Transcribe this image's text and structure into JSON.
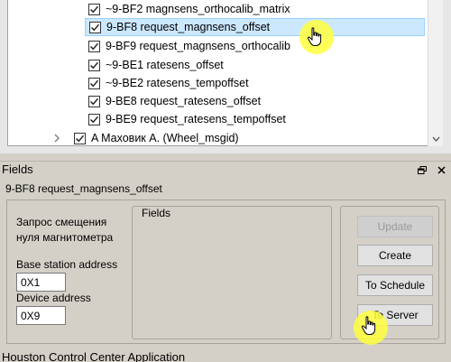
{
  "tree": {
    "items": [
      {
        "label": "~9-BF2 magnsens_orthocalib_matrix",
        "checked": true
      },
      {
        "label": "9-BF8 request_magnsens_offset",
        "checked": true,
        "selected": true
      },
      {
        "label": "9-BF9 request_magnsens_orthocalib",
        "checked": true
      },
      {
        "label": "~9-BE1 ratesens_offset",
        "checked": true
      },
      {
        "label": "~9-BE2 ratesens_tempoffset",
        "checked": true
      },
      {
        "label": "9-BE8 request_ratesens_offset",
        "checked": true
      },
      {
        "label": "9-BE9 request_ratesens_tempoffset",
        "checked": true
      }
    ],
    "collapsed_item": {
      "label": "A Маховик A. (Wheel_msgid)",
      "checked": true
    }
  },
  "fields_panel": {
    "title": "Fields",
    "message_name": "9-BF8 request_magnsens_offset",
    "description": "Запрос смещения нуля магнитометра",
    "base_station_label": "Base station address",
    "base_station_value": "0X1",
    "device_label": "Device address",
    "device_value": "0X9",
    "fields_group_title": "Fields",
    "buttons": {
      "update": "Update",
      "create": "Create",
      "schedule": "To Schedule",
      "server": "To Server"
    }
  },
  "status_bar": {
    "text": "Houston Control Center Application"
  },
  "colors": {
    "selection": "#cce8ff",
    "cursor_highlight": "#ffff3c"
  }
}
